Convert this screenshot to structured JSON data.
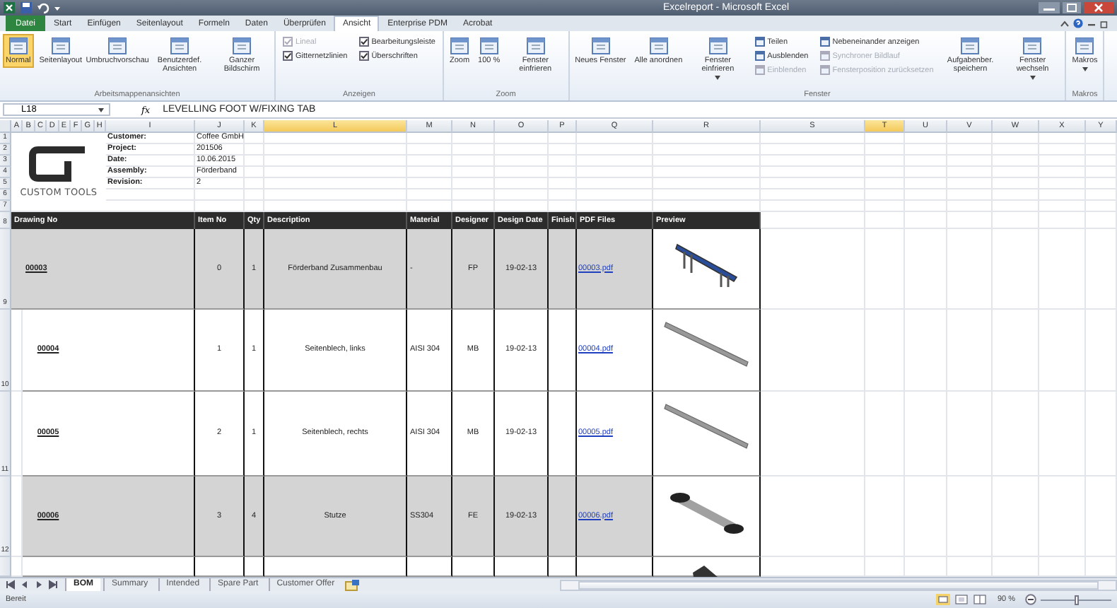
{
  "window": {
    "title": "Excelreport - Microsoft Excel"
  },
  "ribbon": {
    "file_button": "Datei",
    "tabs": [
      {
        "label": "Start",
        "selected": false
      },
      {
        "label": "Einfügen",
        "selected": false
      },
      {
        "label": "Seitenlayout",
        "selected": false
      },
      {
        "label": "Formeln",
        "selected": false
      },
      {
        "label": "Daten",
        "selected": false
      },
      {
        "label": "Überprüfen",
        "selected": false
      },
      {
        "label": "Ansicht",
        "selected": true
      },
      {
        "label": "Enterprise PDM",
        "selected": false
      },
      {
        "label": "Acrobat",
        "selected": false
      }
    ],
    "groups": [
      {
        "label": "Arbeitsmappenansichten",
        "items": [
          {
            "kind": "large",
            "label": "Normal",
            "selected": true
          },
          {
            "kind": "large",
            "label": "Seitenlayout",
            "selected": false
          },
          {
            "kind": "large",
            "label": "Umbruchvorschau",
            "selected": false
          },
          {
            "kind": "large",
            "label": "Benutzerdef. Ansichten",
            "selected": false
          },
          {
            "kind": "large",
            "label": "Ganzer Bildschirm",
            "selected": false
          }
        ]
      },
      {
        "label": "Anzeigen",
        "items": [
          {
            "kind": "check",
            "label": "Lineal",
            "checked": true,
            "disabled": true
          },
          {
            "kind": "check",
            "label": "Gitternetzlinien",
            "checked": true,
            "disabled": false
          },
          {
            "kind": "check",
            "label": "Bearbeitungsleiste",
            "checked": true,
            "disabled": false
          },
          {
            "kind": "check",
            "label": "Überschriften",
            "checked": true,
            "disabled": false
          }
        ]
      },
      {
        "label": "Zoom",
        "items": [
          {
            "kind": "large",
            "label": "Zoom",
            "selected": false
          },
          {
            "kind": "large",
            "label": "100 %",
            "selected": false
          },
          {
            "kind": "large",
            "label": "Fenster einfrieren",
            "selected": false
          }
        ]
      },
      {
        "label": "Fenster",
        "items": [
          {
            "kind": "large",
            "label": "Neues Fenster",
            "selected": false
          },
          {
            "kind": "large",
            "label": "Alle anordnen",
            "selected": false
          },
          {
            "kind": "large",
            "label": "Fenster einfrieren",
            "selected": false,
            "dropdown": true
          },
          {
            "kind": "small",
            "label": "Teilen",
            "disabled": false
          },
          {
            "kind": "small",
            "label": "Ausblenden",
            "disabled": false
          },
          {
            "kind": "small",
            "label": "Einblenden",
            "disabled": true
          },
          {
            "kind": "small",
            "label": "Nebeneinander anzeigen",
            "disabled": false
          },
          {
            "kind": "small",
            "label": "Synchroner Bildlauf",
            "disabled": true
          },
          {
            "kind": "small",
            "label": "Fensterposition zurücksetzen",
            "disabled": true
          },
          {
            "kind": "large",
            "label": "Aufgabenber. speichern",
            "selected": false
          },
          {
            "kind": "large",
            "label": "Fenster wechseln",
            "selected": false,
            "dropdown": true
          }
        ]
      },
      {
        "label": "Makros",
        "items": [
          {
            "kind": "large",
            "label": "Makros",
            "selected": false,
            "dropdown": true
          }
        ]
      }
    ]
  },
  "formula_bar": {
    "name_box": "L18",
    "function_label": "fx",
    "value": "LEVELLING FOOT W/FIXING TAB"
  },
  "sheet": {
    "columns": [
      {
        "label": "A",
        "selected": false
      },
      {
        "label": "B",
        "selected": false
      },
      {
        "label": "C",
        "selected": false
      },
      {
        "label": "D",
        "selected": false
      },
      {
        "label": "E",
        "selected": false
      },
      {
        "label": "F",
        "selected": false
      },
      {
        "label": "G",
        "selected": false
      },
      {
        "label": "H",
        "selected": false
      },
      {
        "label": "I",
        "selected": false
      },
      {
        "label": "J",
        "selected": false
      },
      {
        "label": "K",
        "selected": false
      },
      {
        "label": "L",
        "selected": true
      },
      {
        "label": "M",
        "selected": false
      },
      {
        "label": "N",
        "selected": false
      },
      {
        "label": "O",
        "selected": false
      },
      {
        "label": "P",
        "selected": false
      },
      {
        "label": "Q",
        "selected": false
      },
      {
        "label": "R",
        "selected": false
      },
      {
        "label": "S",
        "selected": false
      },
      {
        "label": "T",
        "selected": true
      },
      {
        "label": "U",
        "selected": false
      },
      {
        "label": "V",
        "selected": false
      },
      {
        "label": "W",
        "selected": false
      },
      {
        "label": "X",
        "selected": false
      },
      {
        "label": "Y",
        "selected": false
      }
    ],
    "logo_text": "CUSTOM TOOLS",
    "top_rows": [
      {
        "number": "1",
        "label": "Customer:",
        "value": "Coffee GmbH"
      },
      {
        "number": "2",
        "label": "Project:",
        "value": "201506"
      },
      {
        "number": "3",
        "label": "Date:",
        "value": "10.06.2015"
      },
      {
        "number": "4",
        "label": "Assembly:",
        "value": "Förderband"
      },
      {
        "number": "5",
        "label": "Revision:",
        "value": "2"
      },
      {
        "number": "6"
      },
      {
        "number": "7"
      }
    ],
    "header_row": {
      "number": "8",
      "cells": [
        "Drawing No",
        "Item No",
        "Qty",
        "Description",
        "Material",
        "Designer",
        "Design Date",
        "Finish",
        "PDF Files",
        "Preview"
      ]
    },
    "rows": [
      {
        "number": "9",
        "shaded": true,
        "drawing_no": "00003",
        "item_no": "0",
        "qty": "1",
        "description": "Förderband Zusammenbau",
        "material": "-",
        "designer": "FP",
        "design_date": "19-02-13",
        "pdf_file": "00003.pdf",
        "preview": {
          "kind": "conveyor"
        },
        "children": [
          {
            "number": "10",
            "shaded": false,
            "drawing_no": "00004",
            "item_no": "1",
            "qty": "1",
            "description": "Seitenblech, links",
            "material": "AISI 304",
            "designer": "MB",
            "design_date": "19-02-13",
            "pdf_file": "00004.pdf",
            "preview": {
              "kind": "rail"
            }
          },
          {
            "number": "11",
            "shaded": false,
            "drawing_no": "00005",
            "item_no": "2",
            "qty": "1",
            "description": "Seitenblech, rechts",
            "material": "AISI 304",
            "designer": "MB",
            "design_date": "19-02-13",
            "pdf_file": "00005.pdf",
            "preview": {
              "kind": "rail"
            }
          },
          {
            "number": "12",
            "shaded": true,
            "drawing_no": "00006",
            "item_no": "3",
            "qty": "4",
            "description": "Stutze",
            "material": "SS304",
            "designer": "FE",
            "design_date": "19-02-13",
            "pdf_file": "00006.pdf",
            "preview": {
              "kind": "strut"
            }
          },
          {
            "shaded": false,
            "preview": {
              "kind": "part"
            }
          }
        ]
      }
    ]
  },
  "sheet_tabs": [
    {
      "label": "BOM",
      "selected": true
    },
    {
      "label": "Summary",
      "selected": false
    },
    {
      "label": "Intended",
      "selected": false
    },
    {
      "label": "Spare Part",
      "selected": false
    },
    {
      "label": "Customer Offer",
      "selected": false
    }
  ],
  "status_bar": {
    "status": "Bereit",
    "zoom": "90 %",
    "zoom_slider": {
      "level": 0.5
    }
  }
}
